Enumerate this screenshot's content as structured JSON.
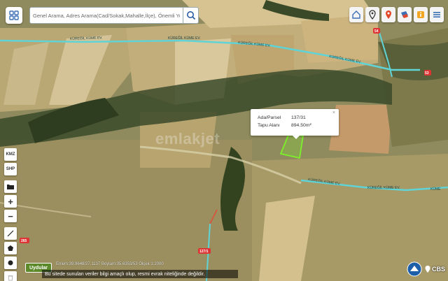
{
  "search": {
    "placeholder": "Genel Arama, Adres Arama(Cad/Sokak,Mahalle,İlçe), Önemli Yer Aranı"
  },
  "toolbar": {
    "buttons": [
      "home-icon",
      "location-pin-icon",
      "map-pin-icon",
      "layers-icon",
      "info-icon",
      "menu-icon"
    ],
    "colors": {
      "home": "#3b6fb6",
      "pin": "#333333",
      "marker": "#e2472a",
      "layers": "#3b6fb6",
      "info": "#f3a623",
      "menu": "#3b6fb6"
    }
  },
  "left_tools": {
    "kmz": "KMZ",
    "shp": "SHP",
    "zoom_in": "+",
    "zoom_out": "−"
  },
  "popup": {
    "rows": [
      {
        "key": "Ada/Parsel",
        "value": "137/31"
      },
      {
        "key": "Tapu Alanı",
        "value": "894.50m²"
      }
    ],
    "close": "×"
  },
  "roads": {
    "label": "KÜREĞİL KÜME EV.",
    "shields": [
      "265",
      "127/1",
      "54",
      "53"
    ]
  },
  "watermark": "emlakjet",
  "bottom": {
    "basemap_button": "Uydular",
    "coords": "Enlem:39.9648/27.1137 Boylam:35.6353/53 Ölçek:1:2000",
    "disclaimer": "Bu sitede sunulan veriler bilgi amaçlı olup, resmi evrak niteliğinde değildir.",
    "brand": "CBS"
  },
  "colors": {
    "road": "#5fd3d6",
    "parcel": "#7cf02a",
    "basemap_btn": "#5c8a2a"
  }
}
